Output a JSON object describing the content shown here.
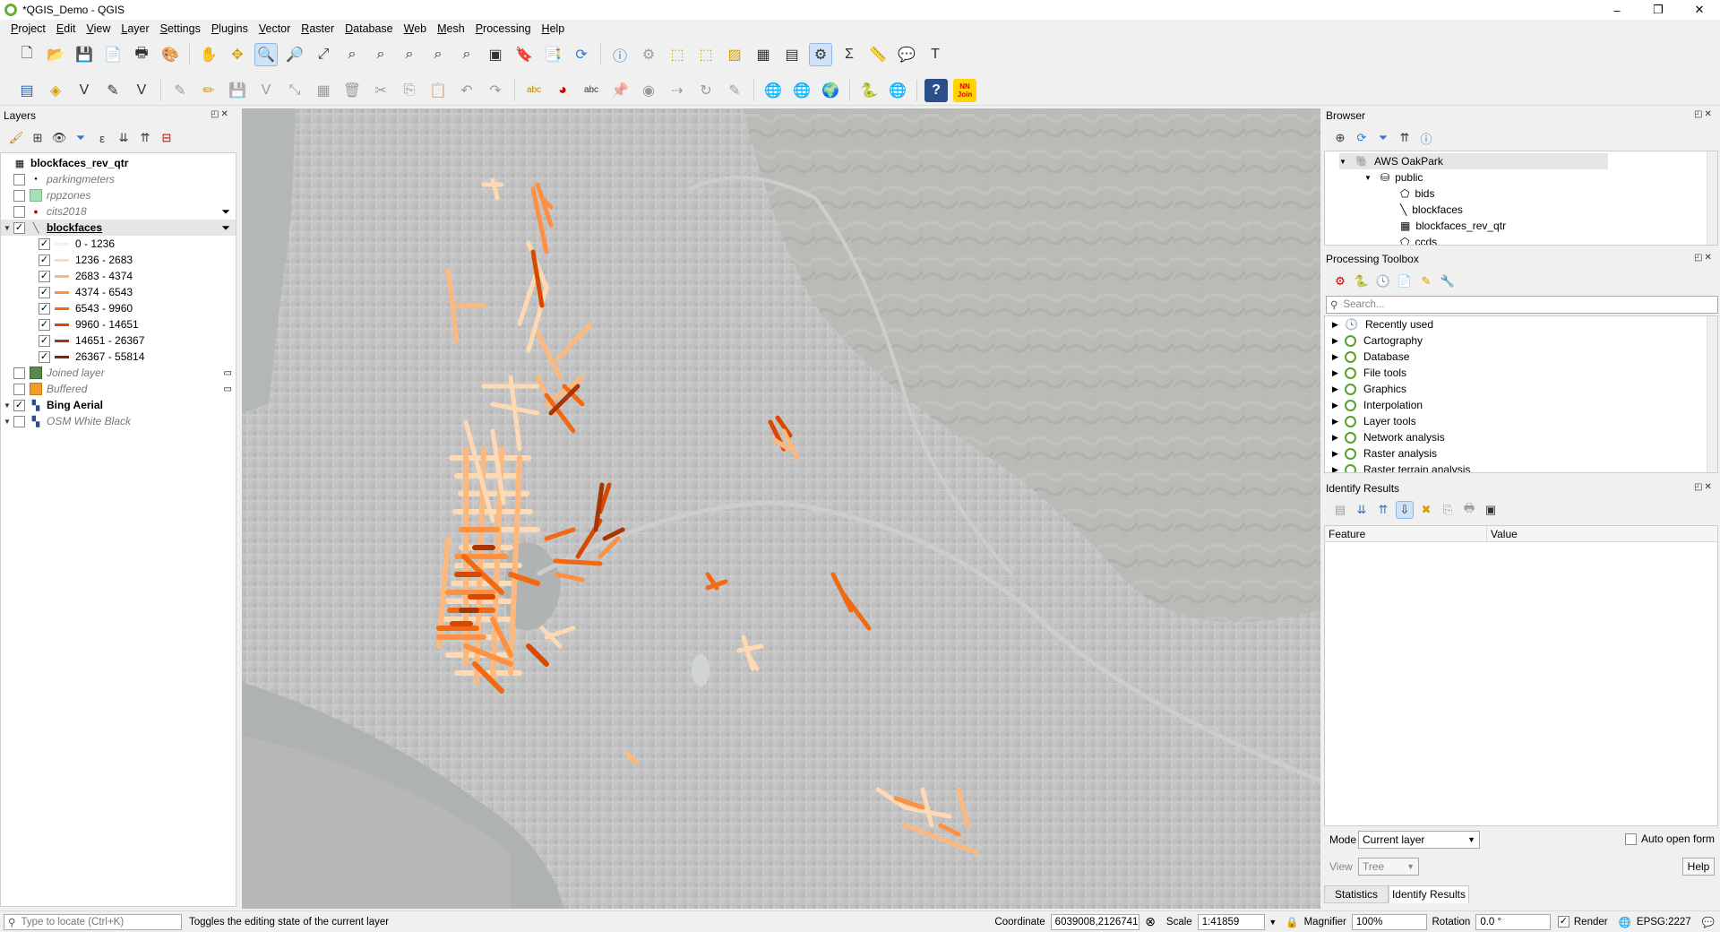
{
  "window": {
    "title": "*QGIS_Demo - QGIS",
    "minimize": "–",
    "maximize": "❐",
    "close": "✕"
  },
  "menu": [
    "Project",
    "Edit",
    "View",
    "Layer",
    "Settings",
    "Plugins",
    "Vector",
    "Raster",
    "Database",
    "Web",
    "Mesh",
    "Processing",
    "Help"
  ],
  "layers_panel": {
    "title": "Layers",
    "items": [
      {
        "label": "blockfaces_rev_qtr",
        "style": "bold",
        "checked": null,
        "icon": "table-icon"
      },
      {
        "label": "parkingmeters",
        "style": "italic",
        "checked": false,
        "icon": "point-icon"
      },
      {
        "label": "rppzones",
        "style": "italic",
        "checked": false,
        "icon": "polygon-icon"
      },
      {
        "label": "cits2018",
        "style": "italic",
        "checked": false,
        "icon": "red-point-icon"
      },
      {
        "label": "blockfaces",
        "style": "bold-underline",
        "checked": true,
        "icon": "line-icon"
      },
      {
        "label": "Joined layer",
        "style": "italic",
        "checked": false,
        "icon": "polygon-icon"
      },
      {
        "label": "Buffered",
        "style": "italic",
        "checked": false,
        "icon": "polygon-icon"
      },
      {
        "label": "Bing Aerial",
        "style": "bold",
        "checked": true,
        "icon": "raster-icon"
      },
      {
        "label": "OSM White Black",
        "style": "italic",
        "checked": false,
        "icon": "raster-icon"
      }
    ],
    "legend": [
      {
        "label": "0 - 1236",
        "color": "#fff5eb"
      },
      {
        "label": "1236 - 2683",
        "color": "#fdd9b4"
      },
      {
        "label": "2683 - 4374",
        "color": "#fdb97d"
      },
      {
        "label": "4374 - 6543",
        "color": "#fd9141"
      },
      {
        "label": "6543 - 9960",
        "color": "#f16913"
      },
      {
        "label": "9960 - 14651",
        "color": "#d94801"
      },
      {
        "label": "14651 - 26367",
        "color": "#a63603"
      },
      {
        "label": "26367 - 55814",
        "color": "#7f2704"
      }
    ],
    "check": "✓"
  },
  "browser_panel": {
    "title": "Browser",
    "items": [
      {
        "label": "AWS OakPark",
        "level": 1
      },
      {
        "label": "public",
        "level": 2
      },
      {
        "label": "bids",
        "level": 3
      },
      {
        "label": "blockfaces",
        "level": 3
      },
      {
        "label": "blockfaces_rev_qtr",
        "level": 3
      },
      {
        "label": "ccds",
        "level": 3
      }
    ]
  },
  "toolbox_panel": {
    "title": "Processing Toolbox",
    "search_placeholder": "Search...",
    "items": [
      "Recently used",
      "Cartography",
      "Database",
      "File tools",
      "Graphics",
      "Interpolation",
      "Layer tools",
      "Network analysis",
      "Raster analysis",
      "Raster terrain analysis"
    ]
  },
  "identify_panel": {
    "title": "Identify Results",
    "col_feature": "Feature",
    "col_value": "Value",
    "mode_label": "Mode",
    "mode_value": "Current layer",
    "view_label": "View",
    "view_value": "Tree",
    "auto_open": "Auto open form",
    "help": "Help",
    "tabs": [
      "Statistics",
      "Identify Results"
    ]
  },
  "statusbar": {
    "locate_placeholder": "Type to locate (Ctrl+K)",
    "message": "Toggles the editing state of the current layer",
    "coordinate_label": "Coordinate",
    "coordinate_value": "6039008,2126741",
    "scale_label": "Scale",
    "scale_value": "1:41859",
    "magnifier_label": "Magnifier",
    "magnifier_value": "100%",
    "rotation_label": "Rotation",
    "rotation_value": "0.0 °",
    "render_label": "Render",
    "crs": "EPSG:2227"
  },
  "toolbar2_badge": "NN\nJoin"
}
